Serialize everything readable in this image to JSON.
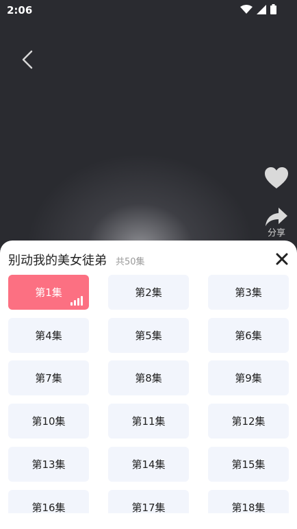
{
  "status": {
    "time": "2:06"
  },
  "side": {
    "share_label": "分享"
  },
  "sheet": {
    "title": "别动我的美女徒弟",
    "episode_count": "共50集",
    "episodes": [
      "第1集",
      "第2集",
      "第3集",
      "第4集",
      "第5集",
      "第6集",
      "第7集",
      "第8集",
      "第9集",
      "第10集",
      "第11集",
      "第12集",
      "第13集",
      "第14集",
      "第15集",
      "第16集",
      "第17集",
      "第18集"
    ],
    "active_index": 0,
    "accent_color": "#fc7082"
  }
}
